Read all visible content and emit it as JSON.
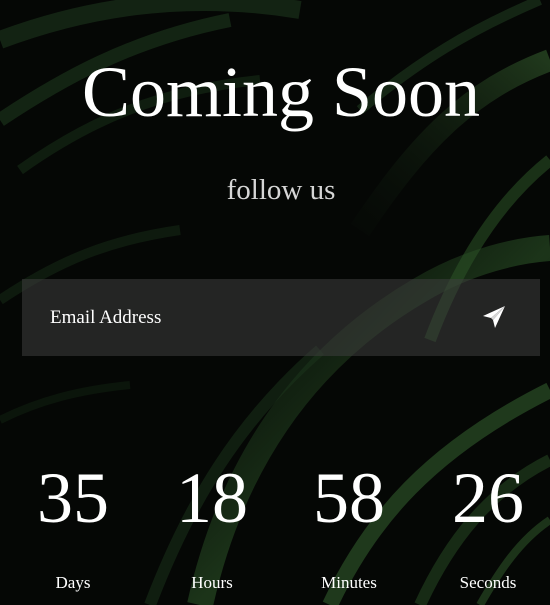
{
  "title": "Coming Soon",
  "subtitle": "follow us",
  "subscribe": {
    "placeholder": "Email Address",
    "send_icon": "paper-plane-icon"
  },
  "countdown": [
    {
      "value": "35",
      "label": "Days"
    },
    {
      "value": "18",
      "label": "Hours"
    },
    {
      "value": "58",
      "label": "Minutes"
    },
    {
      "value": "26",
      "label": "Seconds"
    }
  ],
  "colors": {
    "background": "#050705",
    "text": "#ffffff",
    "subtitle": "#d6d6d6",
    "leaf_green": "#2f5a2a"
  }
}
